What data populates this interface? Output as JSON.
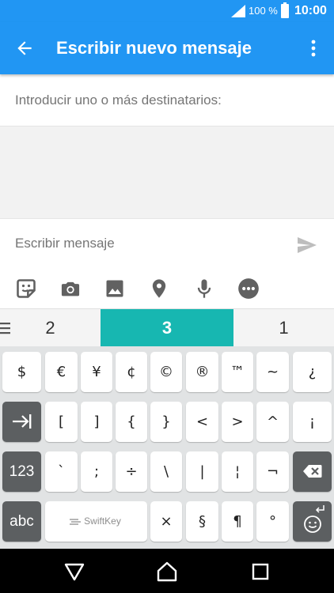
{
  "status_bar": {
    "battery_percent": "100 %",
    "time": "10:00",
    "icons": [
      "signal-icon",
      "battery-icon"
    ]
  },
  "app_bar": {
    "title": "Escribir nuevo mensaje",
    "icons": [
      "back-arrow-icon",
      "more-vert-icon"
    ]
  },
  "recipients": {
    "placeholder": "Introducir uno o más destinatarios:"
  },
  "compose": {
    "placeholder": "Escribir mensaje",
    "icons": [
      "send-icon",
      "sticker-icon",
      "camera-icon",
      "image-icon",
      "location-icon",
      "microphone-icon",
      "more-options-icon"
    ]
  },
  "suggestions": {
    "items": [
      "2",
      "3",
      "1"
    ],
    "active_index": 1,
    "accent_color": "#17b7b1"
  },
  "keyboard": {
    "row1": [
      "$",
      "€",
      "¥",
      "¢",
      "©",
      "®",
      "™",
      "~",
      "¿"
    ],
    "row2": [
      "[",
      "]",
      "{",
      "}",
      "<",
      ">",
      "^",
      "¡"
    ],
    "row3": [
      "`",
      ";",
      "÷",
      "\\",
      "|",
      "¦",
      "¬"
    ],
    "row4": [
      "×",
      "§",
      "¶",
      "°"
    ],
    "tab_key_icon": "tab-icon",
    "numbers_label": "123",
    "abc_label": "abc",
    "space_brand": "SwiftKey",
    "backspace_icon": "backspace-icon",
    "emoji_enter_icons": [
      "enter-icon",
      "emoji-icon"
    ]
  },
  "nav_bar": {
    "icons": [
      "back-triangle-icon",
      "home-icon",
      "recents-icon"
    ]
  },
  "colors": {
    "primary": "#2196f3",
    "keyboard_bg": "#e1e3e4",
    "dark_key": "#5c5f61"
  }
}
